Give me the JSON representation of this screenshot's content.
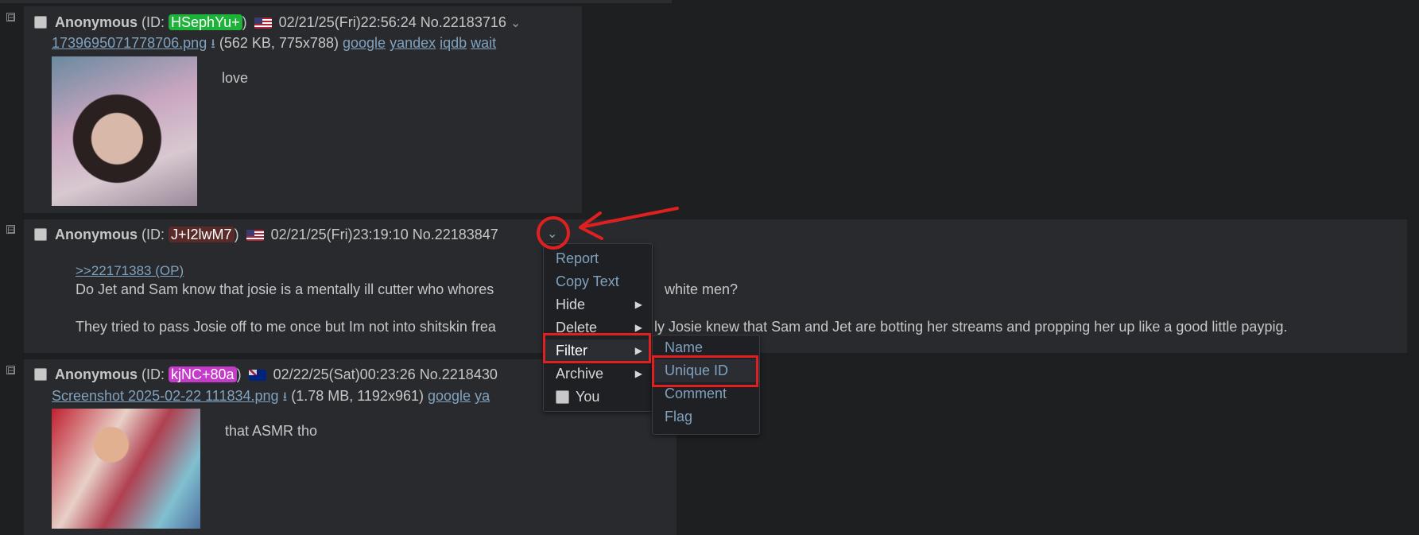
{
  "posts": [
    {
      "name": "Anonymous",
      "id_prefix": "(ID: ",
      "id": "HSephYu+",
      "id_suffix": ")",
      "id_color": "#1db33a",
      "flag": "US",
      "datetime": "02/21/25(Fri)22:56:24",
      "no": "No.22183716",
      "chevron": "⌄",
      "file": {
        "name": "1739695071778706.png",
        "info": "(562 KB, 775x788)",
        "links": [
          "google",
          "yandex",
          "iqdb",
          "wait"
        ]
      },
      "comment": [
        "love"
      ]
    },
    {
      "name": "Anonymous",
      "id_prefix": "(ID: ",
      "id": "J+I2lwM7",
      "id_suffix": ")",
      "id_color": "#5a2a28",
      "flag": "US",
      "datetime": "02/21/25(Fri)23:19:10",
      "no": "No.22183847",
      "chevron": "⌄",
      "quote": ">>22171383 (OP)",
      "comment": [
        "Do Jet and Sam know that josie is a mentally ill cutter who whores",
        "white men?",
        "They tried to pass Josie off to me once but Im not into shitskin frea",
        "ly Josie knew that Sam and Jet are botting her streams and propping her up like a good little paypig."
      ]
    },
    {
      "name": "Anonymous",
      "id_prefix": "(ID: ",
      "id": "kjNC+80a",
      "id_suffix": ")",
      "id_color": "#c43bc9",
      "flag": "AU",
      "datetime": "02/22/25(Sat)00:23:26",
      "no": "No.2218430",
      "file": {
        "name": "Screenshot 2025-02-22 111834.png",
        "info": "(1.78 MB, 1192x961)",
        "links": [
          "google",
          "ya"
        ]
      },
      "comment": [
        "that ASMR tho"
      ]
    }
  ],
  "menu": {
    "items": [
      "Report",
      "Copy Text",
      "Hide",
      "Delete",
      "Filter",
      "Archive",
      "You"
    ],
    "submenu_arrow": "▶"
  },
  "submenu": {
    "items": [
      "Name",
      "Unique ID",
      "Comment",
      "Flag"
    ]
  },
  "icons": {
    "collapse": "⊟",
    "download": "download-icon"
  },
  "colors": {
    "annotation": "#e02020",
    "link": "#81a2be",
    "background": "#1d1f21",
    "post_bg": "#282a2e"
  }
}
